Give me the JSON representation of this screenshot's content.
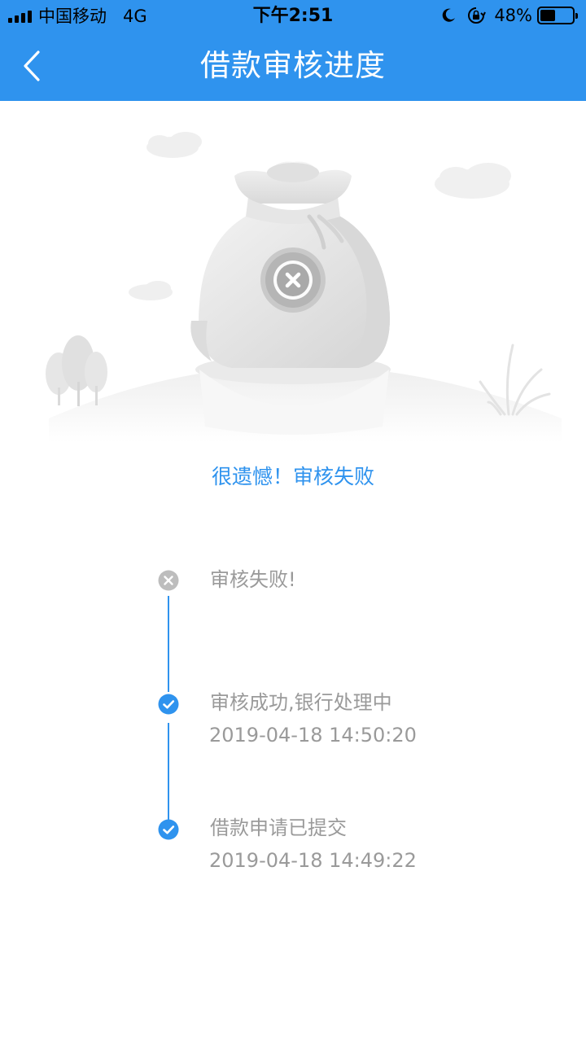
{
  "status_bar": {
    "carrier": "中国移动",
    "network": "4G",
    "time": "下午2:51",
    "battery_percent": "48%",
    "battery_level": 0.48
  },
  "nav": {
    "title": "借款审核进度",
    "back_icon": "chevron-left-icon"
  },
  "hero": {
    "illustration": "money-bag-failed-illustration",
    "badge_icon": "close-icon"
  },
  "result": {
    "message": "很遗憾！审核失败"
  },
  "timeline": {
    "steps": [
      {
        "status": "failed",
        "icon": "close-circle-icon",
        "title": "审核失败!",
        "time": ""
      },
      {
        "status": "done",
        "icon": "check-circle-icon",
        "title": "审核成功,银行处理中",
        "time": "2019-04-18 14:50:20"
      },
      {
        "status": "done",
        "icon": "check-circle-icon",
        "title": "借款申请已提交",
        "time": "2019-04-18 14:49:22"
      }
    ]
  },
  "colors": {
    "brand": "#2f93ee",
    "text_muted": "#9a9a9a",
    "failed": "#bdbdbd"
  }
}
